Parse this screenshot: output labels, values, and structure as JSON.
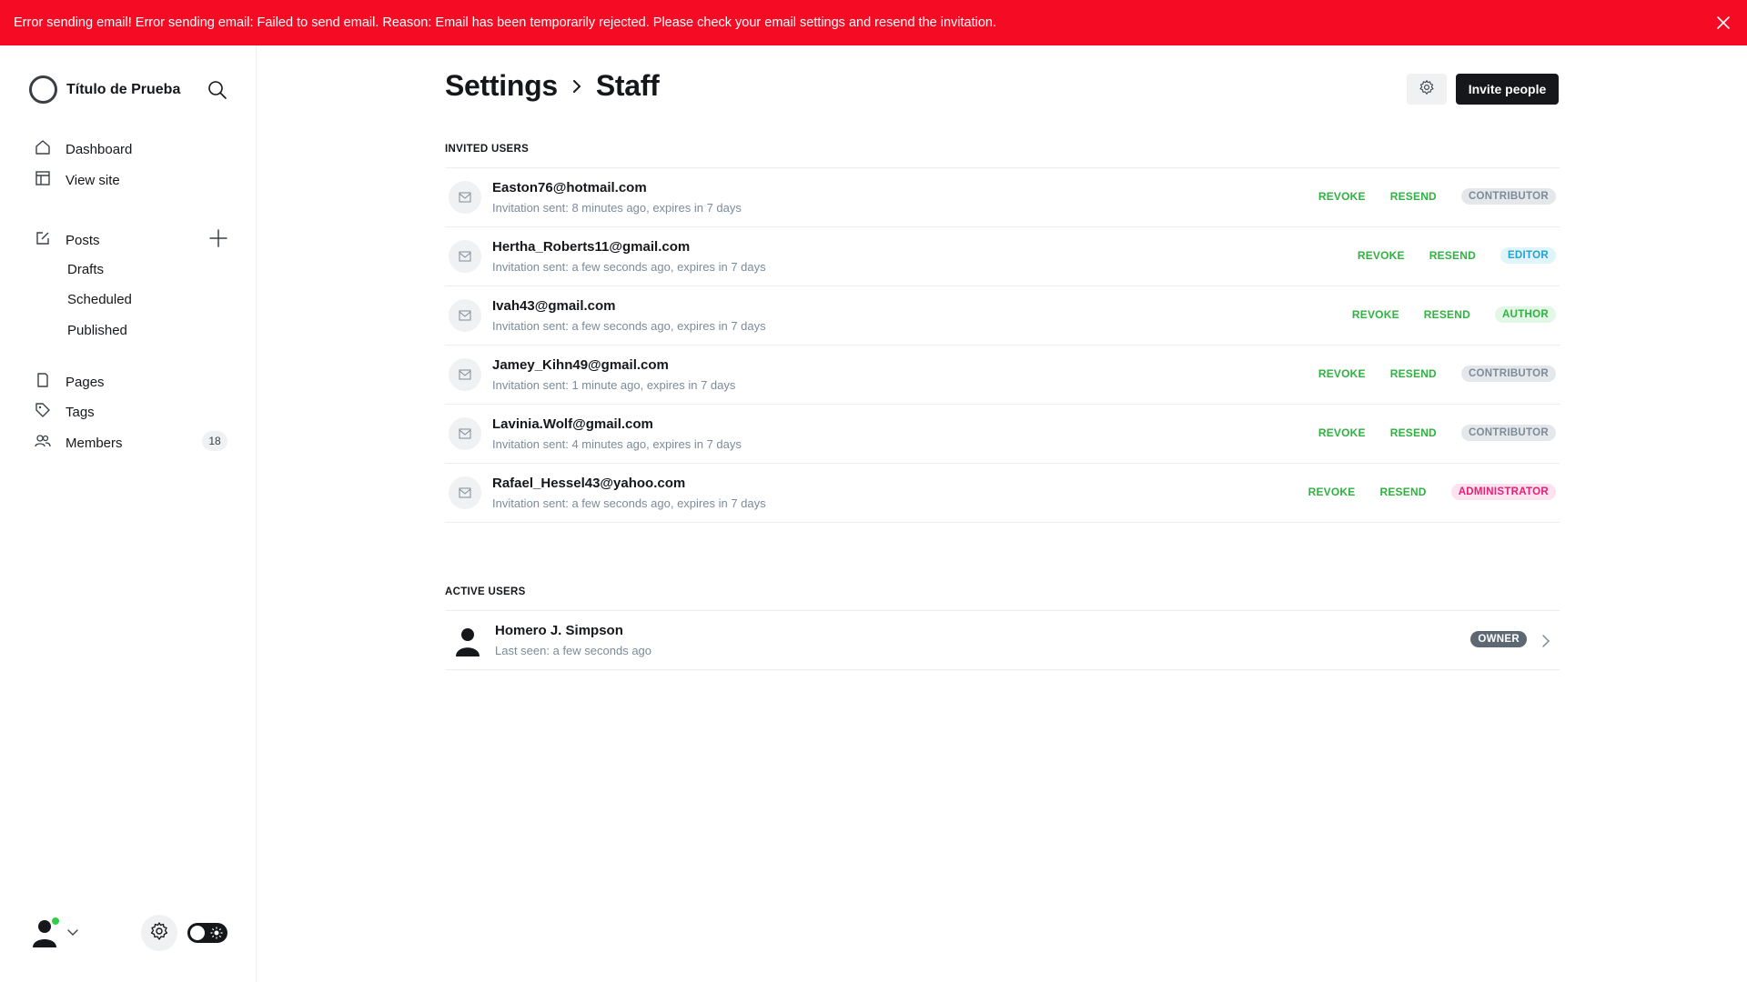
{
  "alert": {
    "message": "Error sending email! Error sending email: Failed to send email. Reason: Email has been temporarily rejected. Please check your email settings and resend the invitation.",
    "color": "#f50b23"
  },
  "sidebar": {
    "site_title": "Título de Prueba",
    "nav": [
      {
        "label": "Dashboard",
        "icon": "home-icon"
      },
      {
        "label": "View site",
        "icon": "layout-icon"
      },
      {
        "label": "Posts",
        "icon": "pencil-icon"
      },
      {
        "label": "Pages",
        "icon": "page-icon"
      },
      {
        "label": "Tags",
        "icon": "tag-icon"
      },
      {
        "label": "Members",
        "icon": "members-icon"
      }
    ],
    "post_subitems": [
      "Drafts",
      "Scheduled",
      "Published"
    ],
    "members_count": "18"
  },
  "header": {
    "breadcrumb_parent": "Settings",
    "breadcrumb_current": "Staff",
    "invite_label": "Invite people"
  },
  "invited": {
    "section_label": "INVITED USERS",
    "revoke_label": "REVOKE",
    "resend_label": "RESEND",
    "users": [
      {
        "email": "Easton76@hotmail.com",
        "sub": "Invitation sent: 8 minutes ago, expires in 7 days",
        "role": "CONTRIBUTOR"
      },
      {
        "email": "Hertha_Roberts11@gmail.com",
        "sub": "Invitation sent: a few seconds ago, expires in 7 days",
        "role": "EDITOR"
      },
      {
        "email": "Ivah43@gmail.com",
        "sub": "Invitation sent: a few seconds ago, expires in 7 days",
        "role": "AUTHOR"
      },
      {
        "email": "Jamey_Kihn49@gmail.com",
        "sub": "Invitation sent: 1 minute ago, expires in 7 days",
        "role": "CONTRIBUTOR"
      },
      {
        "email": "Lavinia.Wolf@gmail.com",
        "sub": "Invitation sent: 4 minutes ago, expires in 7 days",
        "role": "CONTRIBUTOR"
      },
      {
        "email": "Rafael_Hessel43@yahoo.com",
        "sub": "Invitation sent: a few seconds ago, expires in 7 days",
        "role": "ADMINISTRATOR"
      }
    ]
  },
  "active": {
    "section_label": "ACTIVE USERS",
    "users": [
      {
        "name": "Homero J. Simpson",
        "sub": "Last seen: a few seconds ago",
        "role": "OWNER"
      }
    ]
  }
}
